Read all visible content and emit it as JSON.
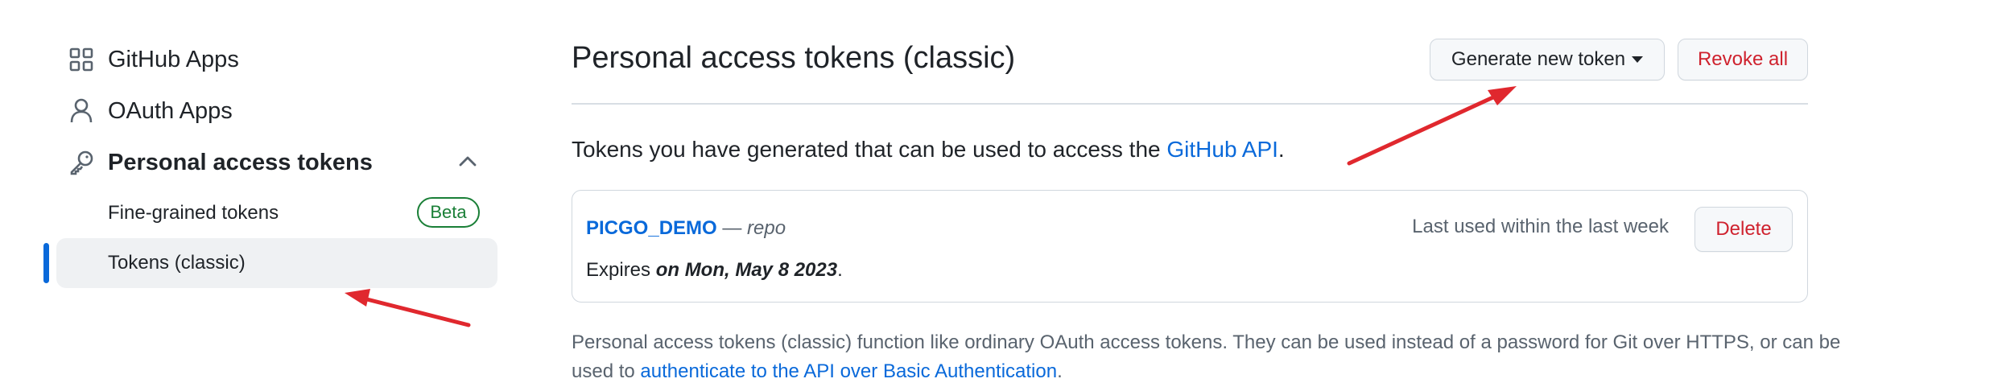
{
  "sidebar": {
    "items": [
      {
        "label": "GitHub Apps",
        "icon": "apps-grid-icon"
      },
      {
        "label": "OAuth Apps",
        "icon": "person-icon"
      },
      {
        "label": "Personal access tokens",
        "icon": "key-icon"
      }
    ],
    "subitems": [
      {
        "label": "Fine-grained tokens",
        "badge": "Beta"
      },
      {
        "label": "Tokens (classic)",
        "selected": true
      }
    ]
  },
  "main": {
    "title": "Personal access tokens (classic)",
    "generate_button": "Generate new token",
    "revoke_button": "Revoke all",
    "intro_prefix": "Tokens you have generated that can be used to access the ",
    "intro_link": "GitHub API",
    "intro_suffix": ".",
    "token": {
      "name": "PICGO_DEMO",
      "separator": " — ",
      "scope": "repo",
      "last_used": "Last used within the last week",
      "delete_button": "Delete",
      "expires_prefix": "Expires ",
      "expires_date": "on Mon, May 8 2023",
      "expires_suffix": "."
    },
    "footer_line1": "Personal access tokens (classic) function like ordinary OAuth access tokens. They can be used instead of a password for Git over HTTPS, or can be",
    "footer_prefix": "used to ",
    "footer_link": "authenticate to the API over Basic Authentication",
    "footer_suffix": "."
  },
  "colors": {
    "accent": "#0969da",
    "danger": "#cf222e",
    "success": "#1a7f37",
    "arrow": "#e0282e",
    "selected_bg": "#eff1f3",
    "selected_marker": "#0969da"
  }
}
